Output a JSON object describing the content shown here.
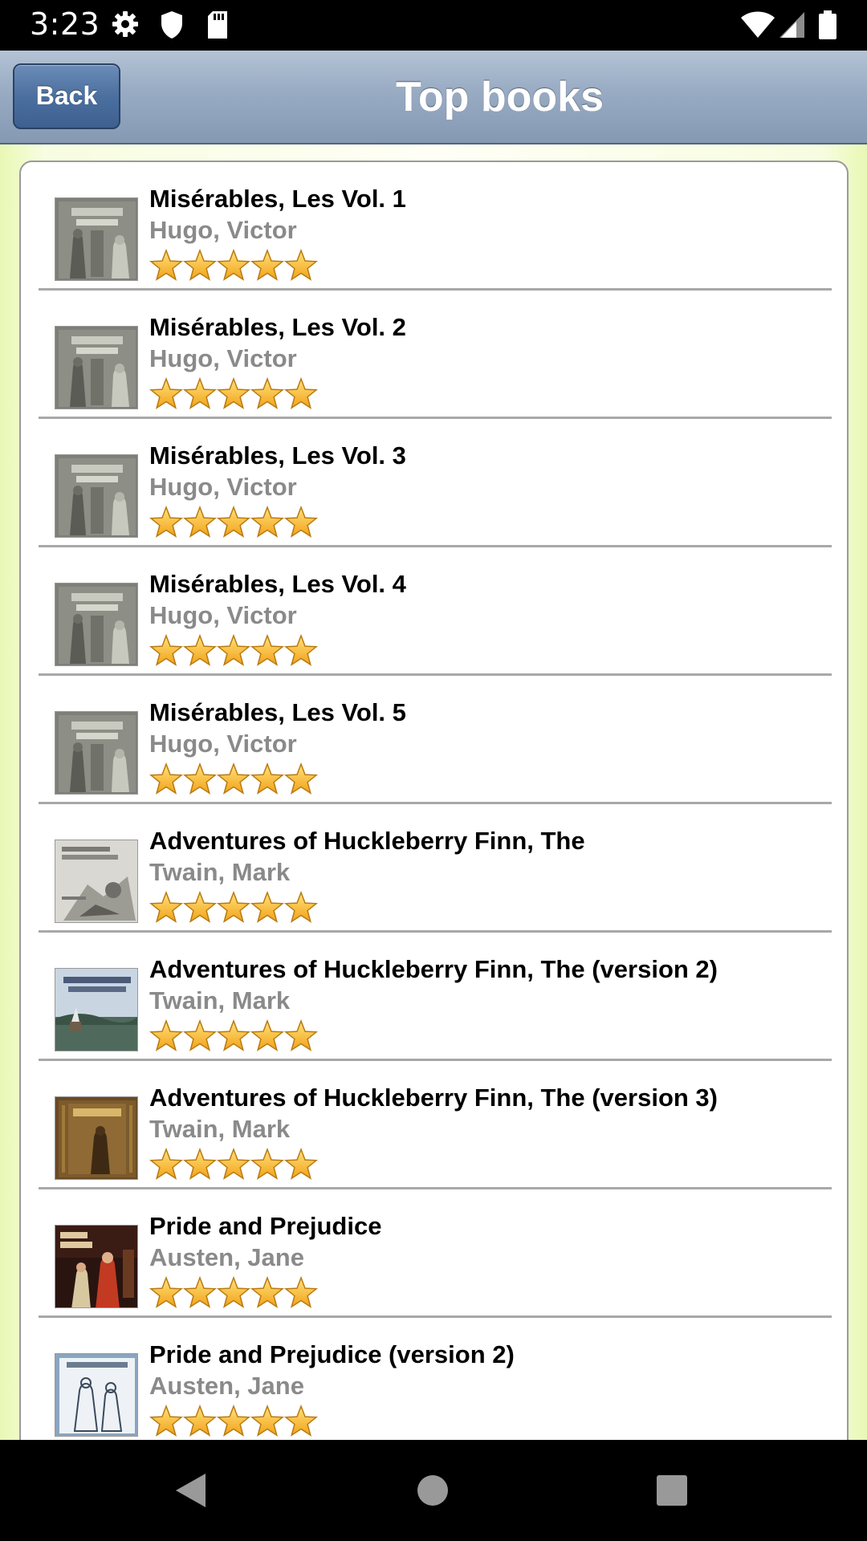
{
  "status_bar": {
    "time": "3:23",
    "left_icons": [
      "gear-icon",
      "shield-icon",
      "sd-card-icon"
    ],
    "right_icons": [
      "wifi-icon",
      "signal-icon",
      "battery-icon"
    ]
  },
  "header": {
    "back_label": "Back",
    "title": "Top books"
  },
  "books": [
    {
      "title": "Misérables, Les Vol. 1",
      "author": "Hugo, Victor",
      "rating": 5,
      "cover": "miserables"
    },
    {
      "title": "Misérables, Les Vol. 2",
      "author": "Hugo, Victor",
      "rating": 5,
      "cover": "miserables"
    },
    {
      "title": "Misérables, Les Vol. 3",
      "author": "Hugo, Victor",
      "rating": 5,
      "cover": "miserables"
    },
    {
      "title": "Misérables, Les Vol. 4",
      "author": "Hugo, Victor",
      "rating": 5,
      "cover": "miserables"
    },
    {
      "title": "Misérables, Les Vol. 5",
      "author": "Hugo, Victor",
      "rating": 5,
      "cover": "miserables"
    },
    {
      "title": "Adventures of Huckleberry Finn, The",
      "author": "Twain, Mark",
      "rating": 5,
      "cover": "huck-sketch"
    },
    {
      "title": "Adventures of Huckleberry Finn, The (version 2)",
      "author": "Twain, Mark",
      "rating": 5,
      "cover": "huck-river"
    },
    {
      "title": "Adventures of Huckleberry Finn, The (version 3)",
      "author": "Twain, Mark",
      "rating": 5,
      "cover": "huck-brown"
    },
    {
      "title": "Pride and Prejudice",
      "author": "Austen, Jane",
      "rating": 5,
      "cover": "pride-painting"
    },
    {
      "title": "Pride and Prejudice (version 2)",
      "author": "Austen, Jane",
      "rating": 5,
      "cover": "pride-sketch"
    }
  ],
  "nav_bar": {
    "icons": [
      "back-triangle-icon",
      "home-circle-icon",
      "recents-square-icon"
    ]
  },
  "colors": {
    "header_gradient_top": "#b4c3d5",
    "header_gradient_bottom": "#8599b3",
    "back_button": "#4b6f9f",
    "author_text": "#8a8a8a",
    "star_fill": "#f7b733",
    "page_background_edge": "#e8f8b4"
  }
}
